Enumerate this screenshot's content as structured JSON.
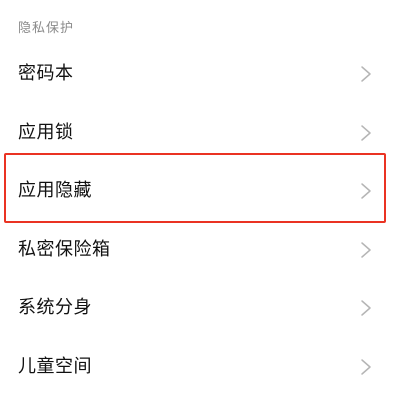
{
  "section": {
    "title": "隐私保护"
  },
  "items": [
    {
      "label": "密码本"
    },
    {
      "label": "应用锁"
    },
    {
      "label": "应用隐藏"
    },
    {
      "label": "私密保险箱"
    },
    {
      "label": "系统分身"
    },
    {
      "label": "儿童空间"
    }
  ],
  "colors": {
    "highlight": "#ea3323",
    "chevron": "#b5b5b5",
    "header_text": "#8a8a8a"
  },
  "icons": {
    "row_arrow": "chevron-right-icon"
  }
}
